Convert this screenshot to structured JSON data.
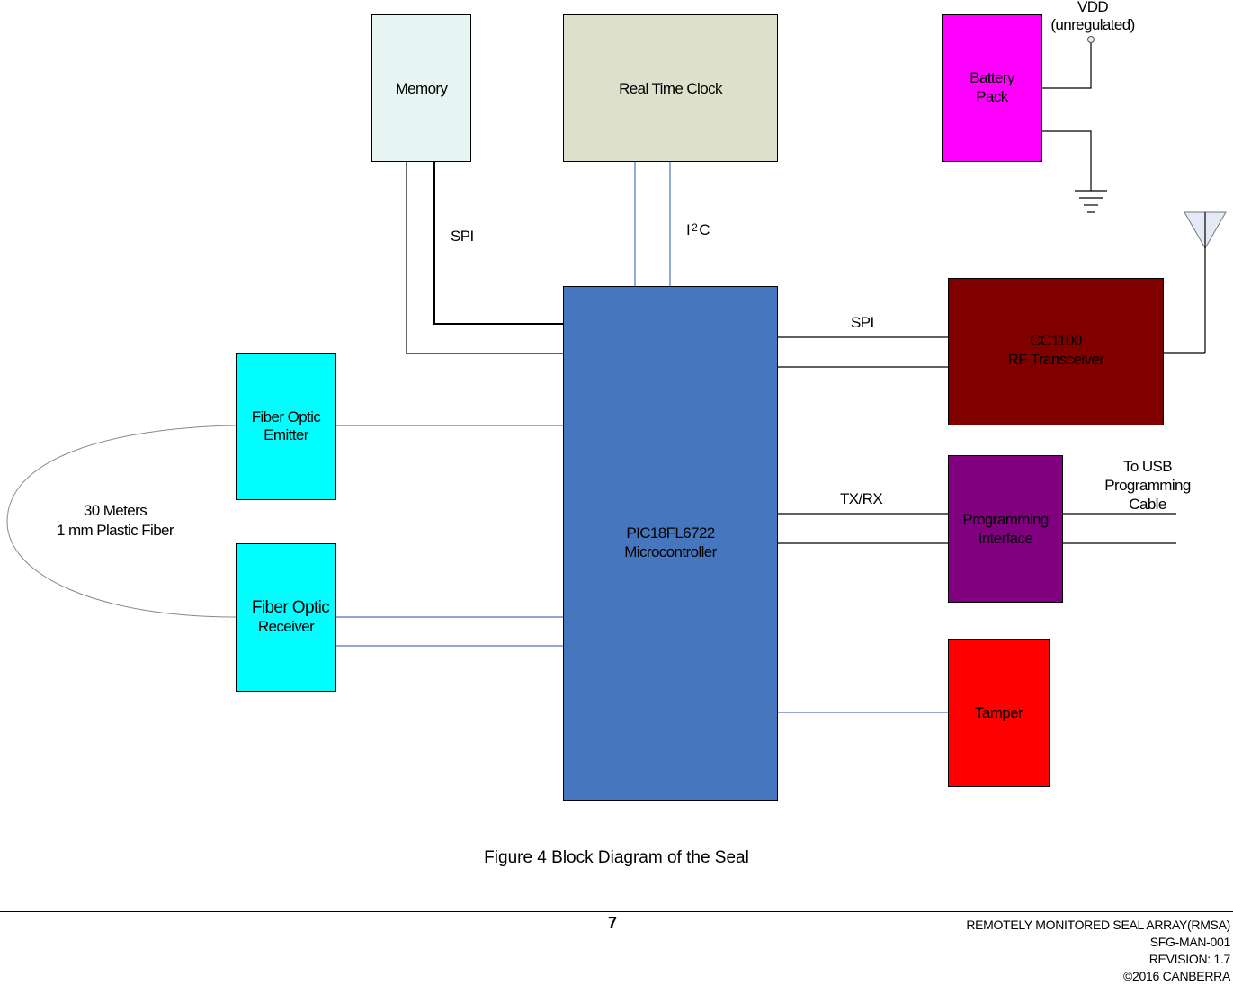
{
  "figure": {
    "caption": "Figure 4 Block Diagram of the Seal"
  },
  "blocks": {
    "memory": {
      "label": "Memory",
      "color": "#e6f5f2"
    },
    "rtc": {
      "label": "Real Time Clock",
      "color": "#dde0cb"
    },
    "battery": {
      "line1": "Battery",
      "line2": "Pack",
      "color": "#ff00ff"
    },
    "mcu": {
      "line1": "PIC18FL6722",
      "line2": "Microcontroller",
      "color": "#4677be"
    },
    "rf": {
      "line1": "CC1100",
      "line2": "RF Transceiver",
      "color": "#800000"
    },
    "prog": {
      "line1": "Programming",
      "line2": "Interface",
      "color": "#800080"
    },
    "tamper": {
      "label": "Tamper",
      "color": "#ff0000"
    },
    "emitter": {
      "line1": "Fiber Optic",
      "line2": "Emitter",
      "color": "#00ffff"
    },
    "receiver": {
      "line1": "Fiber Optic",
      "line2": "Receiver",
      "color": "#00ffff"
    }
  },
  "labels": {
    "vdd": "VDD",
    "vdd_note": "(unregulated)",
    "spi_memory": "SPI",
    "i2c_main": "I",
    "i2c_sup": "2",
    "i2c_tail": "C",
    "spi_rf": "SPI",
    "txrx": "TX/RX",
    "usb_line1": "To USB",
    "usb_line2": "Programming",
    "usb_line3": "Cable",
    "fiber_line1": "30 Meters",
    "fiber_line2": "1 mm Plastic Fiber"
  },
  "footer": {
    "page_number": "7",
    "doc_title": "REMOTELY MONITORED SEAL ARRAY(RMSA)",
    "doc_id": "SFG-MAN-001",
    "revision": "REVISION: 1.7",
    "copyright": "©2016 CANBERRA"
  },
  "colors": {
    "wire": "#000000",
    "bus_wire": "#4677be",
    "antenna_fill": "#e4eaf5",
    "fiber_loop": "#888888"
  }
}
